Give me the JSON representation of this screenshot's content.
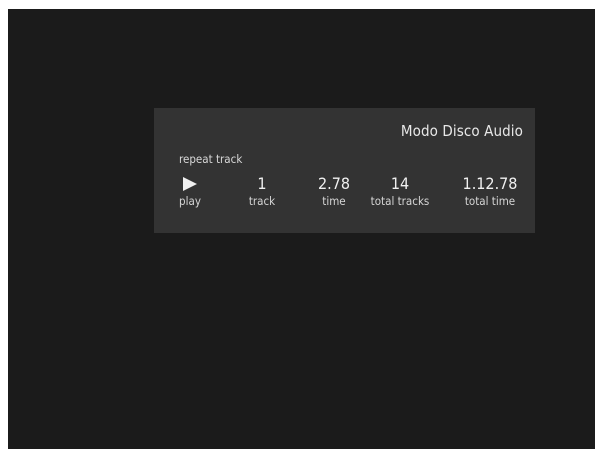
{
  "player": {
    "title": "Modo Disco Audio",
    "mode": "repeat track",
    "controls": {
      "play": {
        "icon": "play-icon",
        "label": "play"
      }
    },
    "stats": {
      "track": {
        "value": "1",
        "label": "track"
      },
      "time": {
        "value": "2.78",
        "label": "time"
      },
      "total_tracks": {
        "value": "14",
        "label": "total tracks"
      },
      "total_time": {
        "value": "1.12.78",
        "label": "total time"
      }
    }
  },
  "colors": {
    "page_background": "#1b1b1b",
    "panel_background": "#333333",
    "text": "#e6e6e6"
  }
}
